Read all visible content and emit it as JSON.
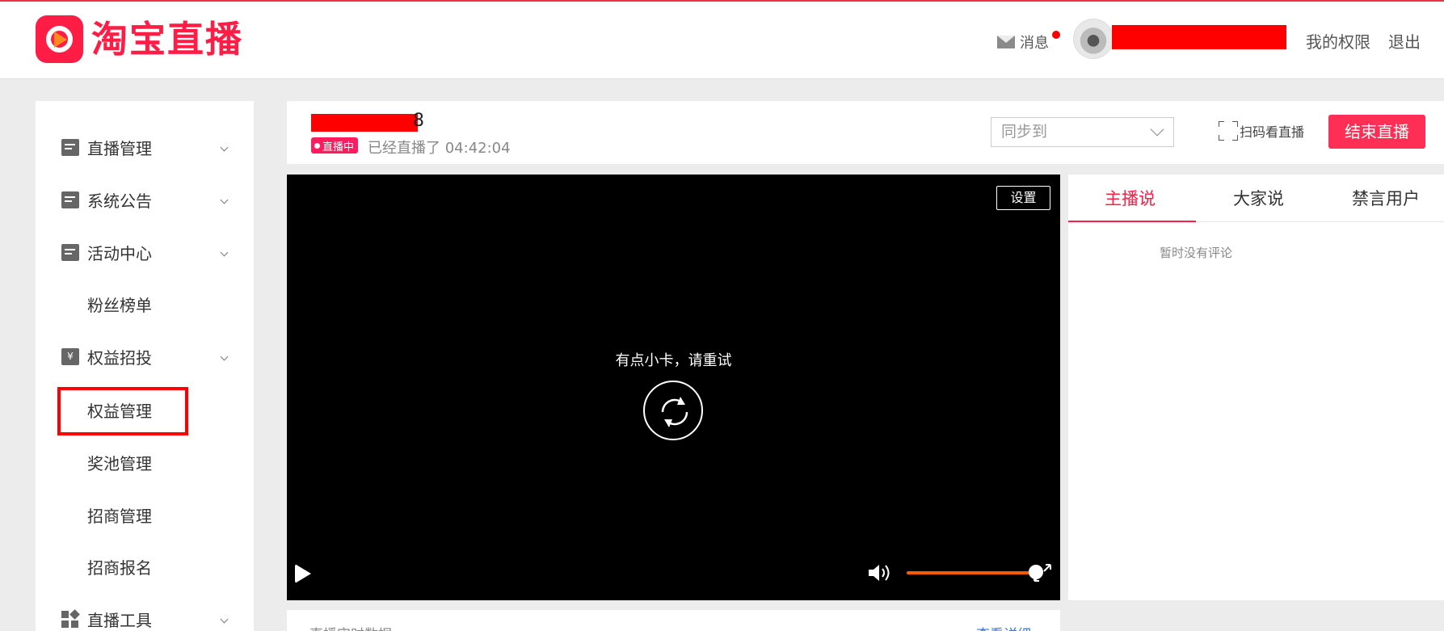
{
  "header": {
    "logo_text": "淘宝直播",
    "messages_label": "消息",
    "my_permissions": "我的权限",
    "logout": "退出"
  },
  "sidebar": {
    "items": [
      {
        "label": "直播管理",
        "icon": "document-icon",
        "expandable": true
      },
      {
        "label": "系统公告",
        "icon": "document-icon",
        "expandable": true
      },
      {
        "label": "活动中心",
        "icon": "document-icon",
        "expandable": true
      },
      {
        "label": "粉丝榜单",
        "icon": "",
        "expandable": false
      },
      {
        "label": "权益招投",
        "icon": "yen-icon",
        "expandable": true
      },
      {
        "label": "权益管理",
        "icon": "",
        "expandable": false,
        "highlighted": true
      },
      {
        "label": "奖池管理",
        "icon": "",
        "expandable": false
      },
      {
        "label": "招商管理",
        "icon": "",
        "expandable": false
      },
      {
        "label": "招商报名",
        "icon": "",
        "expandable": false
      },
      {
        "label": "直播工具",
        "icon": "grid-icon",
        "expandable": true
      }
    ]
  },
  "live": {
    "title_tail": "8",
    "status_badge": "直播中",
    "elapsed_label": "已经直播了 04:42:04",
    "sync_placeholder": "同步到",
    "scan_label": "扫码看直播",
    "end_button": "结束直播"
  },
  "player": {
    "settings": "设置",
    "error_message": "有点小卡，请重试",
    "volume": 1.0
  },
  "comments": {
    "tabs": [
      "主播说",
      "大家说",
      "禁言用户"
    ],
    "active_tab": 0,
    "empty_message": "暂时没有评论"
  },
  "stats": {
    "title": "直播实时数据",
    "detail_link": "查看详细"
  },
  "colors": {
    "brand": "#ff1c45",
    "end_button": "#ff2e55",
    "volume": "#ff5a00",
    "redaction": "#ff0000"
  }
}
